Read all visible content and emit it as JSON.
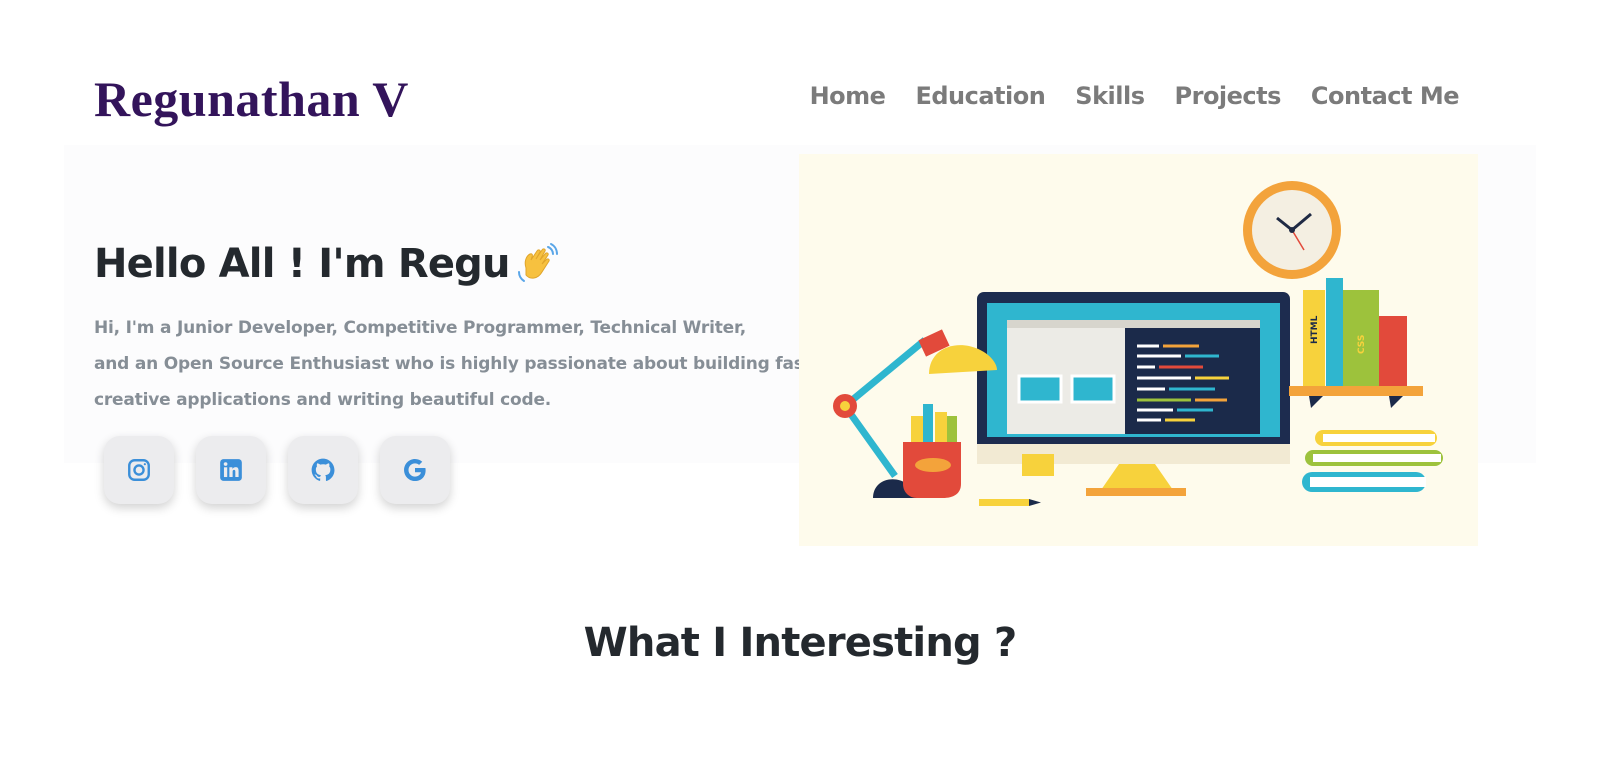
{
  "brand": {
    "logo_text": "Regunathan V",
    "logo_color": "#33145b"
  },
  "nav": {
    "items": [
      "Home",
      "Education",
      "Skills",
      "Projects",
      "Contact Me"
    ]
  },
  "hero": {
    "title": "Hello All ! I'm Regu",
    "title_emoji": "waving-hand",
    "subtitle_lines": [
      "Hi, I'm a Junior Developer, Competitive Programmer, Technical Writer,",
      "and an Open Source Enthusiast who is highly passionate about building fast,",
      "creative applications and writing beautiful code."
    ]
  },
  "socials": [
    {
      "icon": "instagram-icon"
    },
    {
      "icon": "linkedin-icon"
    },
    {
      "icon": "github-icon"
    },
    {
      "icon": "google-icon"
    }
  ],
  "social_icon_color": "#3b8fd9",
  "section": {
    "title": "What I Interesting ?"
  },
  "illustration": {
    "book_labels": [
      "HTML",
      "CSS"
    ]
  }
}
